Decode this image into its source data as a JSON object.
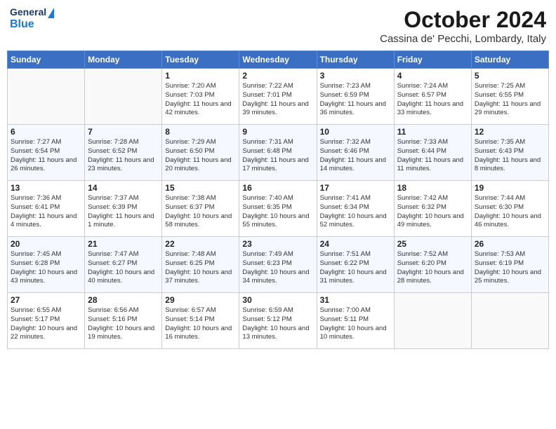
{
  "header": {
    "logo": {
      "general": "General",
      "blue": "Blue"
    },
    "month": "October 2024",
    "location": "Cassina de' Pecchi, Lombardy, Italy"
  },
  "days_of_week": [
    "Sunday",
    "Monday",
    "Tuesday",
    "Wednesday",
    "Thursday",
    "Friday",
    "Saturday"
  ],
  "weeks": [
    {
      "days": [
        {
          "number": "",
          "empty": true
        },
        {
          "number": "",
          "empty": true
        },
        {
          "number": "1",
          "sunrise": "Sunrise: 7:20 AM",
          "sunset": "Sunset: 7:03 PM",
          "daylight": "Daylight: 11 hours and 42 minutes."
        },
        {
          "number": "2",
          "sunrise": "Sunrise: 7:22 AM",
          "sunset": "Sunset: 7:01 PM",
          "daylight": "Daylight: 11 hours and 39 minutes."
        },
        {
          "number": "3",
          "sunrise": "Sunrise: 7:23 AM",
          "sunset": "Sunset: 6:59 PM",
          "daylight": "Daylight: 11 hours and 36 minutes."
        },
        {
          "number": "4",
          "sunrise": "Sunrise: 7:24 AM",
          "sunset": "Sunset: 6:57 PM",
          "daylight": "Daylight: 11 hours and 33 minutes."
        },
        {
          "number": "5",
          "sunrise": "Sunrise: 7:25 AM",
          "sunset": "Sunset: 6:55 PM",
          "daylight": "Daylight: 11 hours and 29 minutes."
        }
      ]
    },
    {
      "days": [
        {
          "number": "6",
          "sunrise": "Sunrise: 7:27 AM",
          "sunset": "Sunset: 6:54 PM",
          "daylight": "Daylight: 11 hours and 26 minutes."
        },
        {
          "number": "7",
          "sunrise": "Sunrise: 7:28 AM",
          "sunset": "Sunset: 6:52 PM",
          "daylight": "Daylight: 11 hours and 23 minutes."
        },
        {
          "number": "8",
          "sunrise": "Sunrise: 7:29 AM",
          "sunset": "Sunset: 6:50 PM",
          "daylight": "Daylight: 11 hours and 20 minutes."
        },
        {
          "number": "9",
          "sunrise": "Sunrise: 7:31 AM",
          "sunset": "Sunset: 6:48 PM",
          "daylight": "Daylight: 11 hours and 17 minutes."
        },
        {
          "number": "10",
          "sunrise": "Sunrise: 7:32 AM",
          "sunset": "Sunset: 6:46 PM",
          "daylight": "Daylight: 11 hours and 14 minutes."
        },
        {
          "number": "11",
          "sunrise": "Sunrise: 7:33 AM",
          "sunset": "Sunset: 6:44 PM",
          "daylight": "Daylight: 11 hours and 11 minutes."
        },
        {
          "number": "12",
          "sunrise": "Sunrise: 7:35 AM",
          "sunset": "Sunset: 6:43 PM",
          "daylight": "Daylight: 11 hours and 8 minutes."
        }
      ]
    },
    {
      "days": [
        {
          "number": "13",
          "sunrise": "Sunrise: 7:36 AM",
          "sunset": "Sunset: 6:41 PM",
          "daylight": "Daylight: 11 hours and 4 minutes."
        },
        {
          "number": "14",
          "sunrise": "Sunrise: 7:37 AM",
          "sunset": "Sunset: 6:39 PM",
          "daylight": "Daylight: 11 hours and 1 minute."
        },
        {
          "number": "15",
          "sunrise": "Sunrise: 7:38 AM",
          "sunset": "Sunset: 6:37 PM",
          "daylight": "Daylight: 10 hours and 58 minutes."
        },
        {
          "number": "16",
          "sunrise": "Sunrise: 7:40 AM",
          "sunset": "Sunset: 6:35 PM",
          "daylight": "Daylight: 10 hours and 55 minutes."
        },
        {
          "number": "17",
          "sunrise": "Sunrise: 7:41 AM",
          "sunset": "Sunset: 6:34 PM",
          "daylight": "Daylight: 10 hours and 52 minutes."
        },
        {
          "number": "18",
          "sunrise": "Sunrise: 7:42 AM",
          "sunset": "Sunset: 6:32 PM",
          "daylight": "Daylight: 10 hours and 49 minutes."
        },
        {
          "number": "19",
          "sunrise": "Sunrise: 7:44 AM",
          "sunset": "Sunset: 6:30 PM",
          "daylight": "Daylight: 10 hours and 46 minutes."
        }
      ]
    },
    {
      "days": [
        {
          "number": "20",
          "sunrise": "Sunrise: 7:45 AM",
          "sunset": "Sunset: 6:28 PM",
          "daylight": "Daylight: 10 hours and 43 minutes."
        },
        {
          "number": "21",
          "sunrise": "Sunrise: 7:47 AM",
          "sunset": "Sunset: 6:27 PM",
          "daylight": "Daylight: 10 hours and 40 minutes."
        },
        {
          "number": "22",
          "sunrise": "Sunrise: 7:48 AM",
          "sunset": "Sunset: 6:25 PM",
          "daylight": "Daylight: 10 hours and 37 minutes."
        },
        {
          "number": "23",
          "sunrise": "Sunrise: 7:49 AM",
          "sunset": "Sunset: 6:23 PM",
          "daylight": "Daylight: 10 hours and 34 minutes."
        },
        {
          "number": "24",
          "sunrise": "Sunrise: 7:51 AM",
          "sunset": "Sunset: 6:22 PM",
          "daylight": "Daylight: 10 hours and 31 minutes."
        },
        {
          "number": "25",
          "sunrise": "Sunrise: 7:52 AM",
          "sunset": "Sunset: 6:20 PM",
          "daylight": "Daylight: 10 hours and 28 minutes."
        },
        {
          "number": "26",
          "sunrise": "Sunrise: 7:53 AM",
          "sunset": "Sunset: 6:19 PM",
          "daylight": "Daylight: 10 hours and 25 minutes."
        }
      ]
    },
    {
      "days": [
        {
          "number": "27",
          "sunrise": "Sunrise: 6:55 AM",
          "sunset": "Sunset: 5:17 PM",
          "daylight": "Daylight: 10 hours and 22 minutes."
        },
        {
          "number": "28",
          "sunrise": "Sunrise: 6:56 AM",
          "sunset": "Sunset: 5:16 PM",
          "daylight": "Daylight: 10 hours and 19 minutes."
        },
        {
          "number": "29",
          "sunrise": "Sunrise: 6:57 AM",
          "sunset": "Sunset: 5:14 PM",
          "daylight": "Daylight: 10 hours and 16 minutes."
        },
        {
          "number": "30",
          "sunrise": "Sunrise: 6:59 AM",
          "sunset": "Sunset: 5:12 PM",
          "daylight": "Daylight: 10 hours and 13 minutes."
        },
        {
          "number": "31",
          "sunrise": "Sunrise: 7:00 AM",
          "sunset": "Sunset: 5:11 PM",
          "daylight": "Daylight: 10 hours and 10 minutes."
        },
        {
          "number": "",
          "empty": true
        },
        {
          "number": "",
          "empty": true
        }
      ]
    }
  ]
}
